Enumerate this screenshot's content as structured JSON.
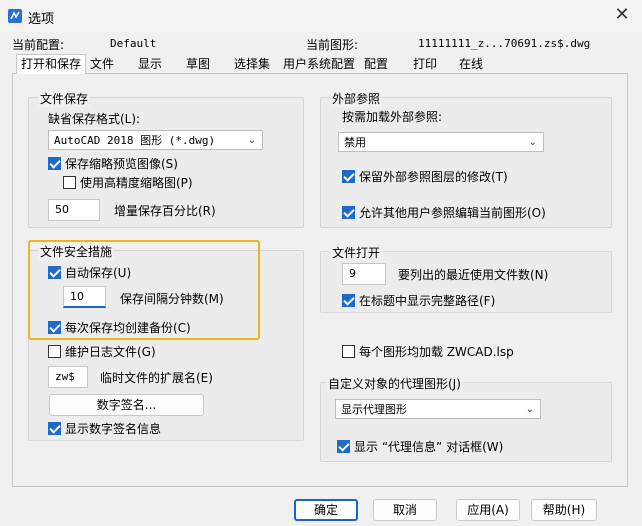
{
  "window": {
    "title": "选项"
  },
  "header": {
    "profile_label": "当前配置:",
    "profile_value": "Default",
    "drawing_label": "当前图形:",
    "drawing_value": "11111111_z...70691.zs$.dwg"
  },
  "tabs": [
    "打开和保存",
    "文件",
    "显示",
    "草图",
    "选择集",
    "用户系统配置",
    "配置",
    "打印",
    "在线"
  ],
  "file_save": {
    "legend": "文件保存",
    "default_format_label": "缺省保存格式(L):",
    "default_format_value": "AutoCAD 2018 图形 (*.dwg)",
    "save_thumbnail": {
      "label": "保存缩略预览图像(S)",
      "checked": true
    },
    "high_precision_thumb": {
      "label": "使用高精度缩略图(P)",
      "checked": false
    },
    "incremental_value": "50",
    "incremental_label": "增量保存百分比(R)"
  },
  "file_safety": {
    "legend": "文件安全措施",
    "autosave": {
      "label": "自动保存(U)",
      "checked": true
    },
    "interval_value": "10",
    "interval_label": "保存间隔分钟数(M)",
    "backup": {
      "label": "每次保存均创建备份(C)",
      "checked": true
    },
    "log_file": {
      "label": "维护日志文件(G)",
      "checked": false
    },
    "temp_ext_value": "zw$",
    "temp_ext_label": "临时文件的扩展名(E)",
    "digital_sig_button": "数字签名...",
    "show_sig_info": {
      "label": "显示数字签名信息",
      "checked": true
    }
  },
  "xref": {
    "legend": "外部参照",
    "demand_load_label": "按需加载外部参照:",
    "demand_load_value": "禁用",
    "retain_changes": {
      "label": "保留外部参照图层的修改(T)",
      "checked": true
    },
    "allow_edit": {
      "label": "允许其他用户参照编辑当前图形(O)",
      "checked": true
    }
  },
  "file_open": {
    "legend": "文件打开",
    "recent_value": "9",
    "recent_label": "要列出的最近使用文件数(N)",
    "full_path": {
      "label": "在标题中显示完整路径(F)",
      "checked": true
    }
  },
  "load_lsp": {
    "label": "每个图形均加载 ZWCAD.lsp",
    "checked": false
  },
  "proxy": {
    "legend": "自定义对象的代理图形(J)",
    "value": "显示代理图形",
    "show_proxy_dialog": {
      "label": "显示 “代理信息” 对话框(W)",
      "checked": true
    }
  },
  "buttons": {
    "ok": "确定",
    "cancel": "取消",
    "apply": "应用(A)",
    "help": "帮助(H)"
  },
  "colors": {
    "accent": "#1d6ac9",
    "highlight": "#f0b41c"
  }
}
